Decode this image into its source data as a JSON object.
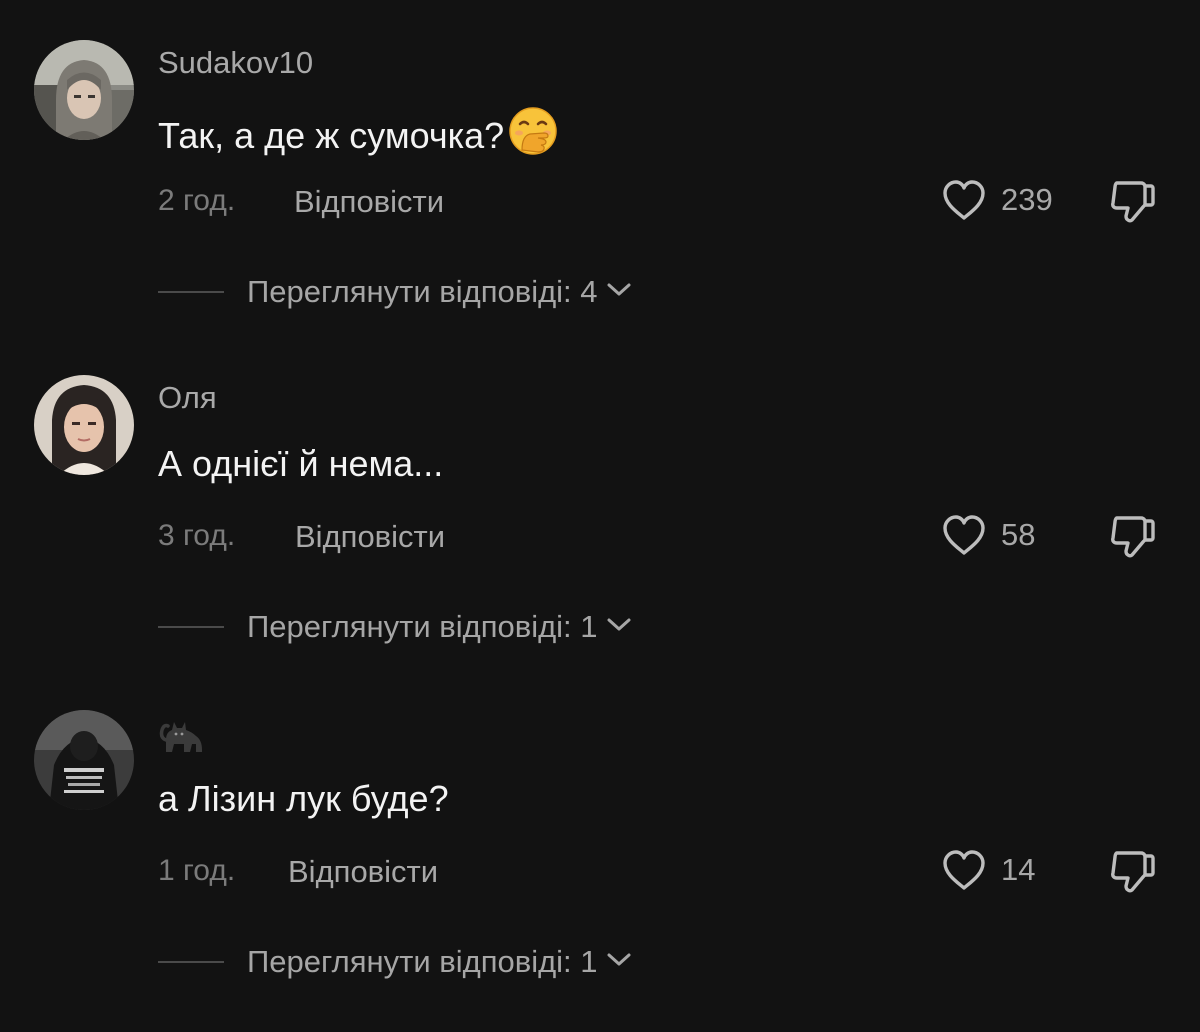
{
  "comments": [
    {
      "username": "Sudakov10",
      "text": "Так, а де ж сумочка?",
      "emoji": "hand-over-mouth-emoji",
      "time": "2 год.",
      "reply_label": "Відповісти",
      "likes": "239",
      "view_replies": "Переглянути відповіді: 4"
    },
    {
      "username": "Оля",
      "text": "А однієї й нема...",
      "time": "3 год.",
      "reply_label": "Відповісти",
      "likes": "58",
      "view_replies": "Переглянути відповіді: 1"
    },
    {
      "username": "🐈‍⬛",
      "text": "а Лізин лук буде?",
      "time": "1 год.",
      "reply_label": "Відповісти",
      "likes": "14",
      "view_replies": "Переглянути відповіді: 1"
    }
  ],
  "colors": {
    "background": "#121212",
    "primary_text": "#f3f3f3",
    "secondary_text": "#a8a8a8",
    "muted_text": "#7b7b7b"
  },
  "icons": {
    "like": "heart-outline-icon",
    "dislike": "thumbs-down-outline-icon",
    "expand": "chevron-down-icon"
  }
}
